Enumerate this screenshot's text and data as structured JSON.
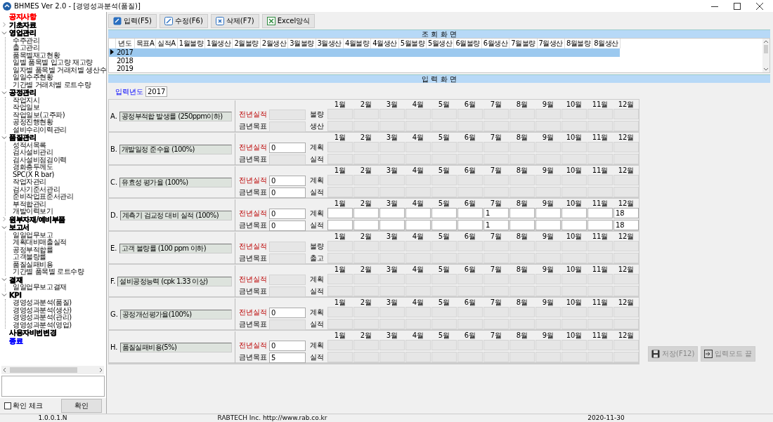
{
  "window": {
    "title": "BHMES Ver 2.0 - [경영성과분석(품질)]"
  },
  "sidebar": {
    "tree": [
      {
        "label": "공지사항",
        "color": "#ff0000"
      },
      {
        "label": "기초자료",
        "color": "#000000",
        "expanded": false
      },
      {
        "label": "영업관리",
        "color": "#000000",
        "expanded": true,
        "children": [
          {
            "label": "수주관리"
          },
          {
            "label": "출고관리"
          },
          {
            "label": "품목별재고현황"
          },
          {
            "label": "일별 품목별 입고량 재고량"
          },
          {
            "label": "일자별 품목별 거래처별 생산수"
          },
          {
            "label": "일일수주현황"
          },
          {
            "label": "기간별 거래처별 로트수량"
          }
        ]
      },
      {
        "label": "공정관리",
        "color": "#000000",
        "expanded": true,
        "children": [
          {
            "label": "작업지시"
          },
          {
            "label": "작업일보"
          },
          {
            "label": "작업일보(고주파)"
          },
          {
            "label": "공정진행현황"
          },
          {
            "label": "설비수리이력관리"
          }
        ]
      },
      {
        "label": "품질관리",
        "color": "#000000",
        "expanded": true,
        "children": [
          {
            "label": "성적서목록"
          },
          {
            "label": "검사설비관리"
          },
          {
            "label": "검사설비점검이력"
          },
          {
            "label": "경화층두께도"
          },
          {
            "label": "SPC(X R bar)"
          },
          {
            "label": "작업자관리"
          },
          {
            "label": "검사기준서관리"
          },
          {
            "label": "준비작업표준서관리"
          },
          {
            "label": "부적합관리"
          },
          {
            "label": "개발이력보기"
          }
        ]
      },
      {
        "label": "원부자재/예비부품",
        "color": "#000000",
        "expanded": false
      },
      {
        "label": "보고서",
        "color": "#000000",
        "expanded": true,
        "children": [
          {
            "label": "일일업무보고"
          },
          {
            "label": "계획대비매출실적"
          },
          {
            "label": "공정부적합률"
          },
          {
            "label": "고객불량률"
          },
          {
            "label": "품질실패비용"
          },
          {
            "label": "기간별 품목별 로트수량"
          }
        ]
      },
      {
        "label": "결재",
        "color": "#000000",
        "expanded": true,
        "children": [
          {
            "label": "일일업무보고결재"
          }
        ]
      },
      {
        "label": "KPI",
        "color": "#000000",
        "expanded": true,
        "children": [
          {
            "label": "경영성과분석(품질)"
          },
          {
            "label": "경영성과분석(생산)"
          },
          {
            "label": "경영성과분석(관리)"
          },
          {
            "label": "경영성과분석(영업)"
          }
        ]
      },
      {
        "label": "사용자비번변경",
        "color": "#000000"
      },
      {
        "label": "종료",
        "color": "#0000ff"
      }
    ],
    "confirm_check": {
      "label": "확인 체크",
      "checked": false
    },
    "confirm_button": "확인"
  },
  "toolbar": [
    {
      "label": "입력(F5)",
      "kind": "input"
    },
    {
      "label": "수정(F6)",
      "kind": "edit"
    },
    {
      "label": "삭제(F7)",
      "kind": "delete"
    },
    {
      "label": "Excel양식",
      "kind": "excel"
    }
  ],
  "query_panel": {
    "title": "조 회 화 면",
    "columns": [
      "년도",
      "목표A",
      "실적A",
      "1월불량",
      "1월생산",
      "2월불량",
      "2월생산",
      "3월불량",
      "3월생산",
      "4월불량",
      "4월생산",
      "5월불량",
      "5월생산",
      "6월불량",
      "6월생산",
      "7월불량",
      "7월생산",
      "8월불량",
      "8월생산"
    ],
    "rows": [
      {
        "year": "2017",
        "selected": true
      },
      {
        "year": "2018",
        "selected": false
      },
      {
        "year": "2019",
        "selected": false
      }
    ]
  },
  "input_panel": {
    "title": "입 력 화 면",
    "year_label": "입력년도",
    "year": "2017",
    "sections": [
      {
        "letter": "A.",
        "title": "공정부적합 발생률 (250ppm이하)",
        "prev": {
          "label": "전년실적"
        },
        "target": {
          "label": "금년목표"
        },
        "months": [
          "1월",
          "2월",
          "3월",
          "4월",
          "5월",
          "6월",
          "7월",
          "8월",
          "9월",
          "10월",
          "11월",
          "12월"
        ],
        "rows": [
          {
            "label": "불량"
          },
          {
            "label": "생산"
          }
        ]
      },
      {
        "letter": "B.",
        "title": "개발일정 준수율 (100%)",
        "prev": {
          "label": "전년실적",
          "value": "0"
        },
        "target": {
          "label": "금년목표"
        },
        "months": [
          "1월",
          "2월",
          "3월",
          "4월",
          "5월",
          "6월",
          "7월",
          "8월",
          "9월",
          "10월",
          "11월",
          "12월"
        ],
        "rows": [
          {
            "label": "계획"
          },
          {
            "label": "실적"
          }
        ]
      },
      {
        "letter": "C.",
        "title": "유효성 평가율 (100%)",
        "prev": {
          "label": "전년실적",
          "value": "0"
        },
        "target": {
          "label": "금년목표",
          "value": "0"
        },
        "months": [
          "1월",
          "2월",
          "3월",
          "4월",
          "5월",
          "6월",
          "7월",
          "8월",
          "9월",
          "10월",
          "11월",
          "12월"
        ],
        "rows": [
          {
            "label": "계획"
          },
          {
            "label": "실적"
          }
        ]
      },
      {
        "letter": "D.",
        "title": "계측기 검교정 대비 실적 (100%)",
        "prev": {
          "label": "전년실적",
          "value": "0"
        },
        "target": {
          "label": "금년목표",
          "value": "0"
        },
        "months": [
          "1월",
          "2월",
          "3월",
          "4월",
          "5월",
          "6월",
          "7월",
          "8월",
          "9월",
          "10월",
          "11월",
          "12월"
        ],
        "rows": [
          {
            "label": "계획",
            "cells": [
              {
                "kind": "blank"
              },
              {
                "kind": "blank"
              },
              {
                "kind": "blank"
              },
              {
                "kind": "blank"
              },
              {
                "kind": "blank"
              },
              {
                "kind": "blank"
              },
              {
                "kind": "value",
                "value": "1"
              },
              {
                "kind": "blank"
              },
              {
                "kind": "blank"
              },
              {
                "kind": "blank"
              },
              {
                "kind": "blank"
              },
              {
                "kind": "value",
                "value": "18"
              }
            ]
          },
          {
            "label": "실적",
            "cells": [
              {
                "kind": "blank"
              },
              {
                "kind": "blank"
              },
              {
                "kind": "blank"
              },
              {
                "kind": "blank"
              },
              {
                "kind": "blank"
              },
              {
                "kind": "blank"
              },
              {
                "kind": "value",
                "value": "1"
              },
              {
                "kind": "blank"
              },
              {
                "kind": "blank"
              },
              {
                "kind": "blank"
              },
              {
                "kind": "blank"
              },
              {
                "kind": "value",
                "value": "18"
              }
            ]
          }
        ]
      },
      {
        "letter": "E.",
        "title": "고객 불량률 (100 ppm 이하)",
        "prev": {
          "label": "전년실적"
        },
        "target": {
          "label": "금년목표"
        },
        "months": [
          "1월",
          "2월",
          "3월",
          "4월",
          "5월",
          "6월",
          "7월",
          "8월",
          "9월",
          "10월",
          "11월",
          "12월"
        ],
        "rows": [
          {
            "label": "불량"
          },
          {
            "label": "출고"
          }
        ]
      },
      {
        "letter": "F.",
        "title": "설비공정능력 (cpk 1.33 이상)",
        "prev": {
          "label": "전년실적"
        },
        "target": {
          "label": "금년목표"
        },
        "months": [
          "1월",
          "2월",
          "3월",
          "4월",
          "5월",
          "6월",
          "7월",
          "8월",
          "9월",
          "10월",
          "11월",
          "12월"
        ],
        "rows": [
          {
            "label": "계획"
          },
          {
            "label": "실적"
          }
        ]
      },
      {
        "letter": "G.",
        "title": "공정개선평가율(100%)",
        "prev": {
          "label": "전년실적",
          "value": "0"
        },
        "target": {
          "label": "금년목표"
        },
        "months": [
          "1월",
          "2월",
          "3월",
          "4월",
          "5월",
          "6월",
          "7월",
          "8월",
          "9월",
          "10월",
          "11월",
          "12월"
        ],
        "rows": [
          {
            "label": "계획"
          },
          {
            "label": "실적"
          }
        ]
      },
      {
        "letter": "H.",
        "title": "품질실패비용(5%)",
        "prev": {
          "label": "전년실적",
          "value": "0"
        },
        "target": {
          "label": "금년목표",
          "value": "5"
        },
        "months": [
          "1월",
          "2월",
          "3월",
          "4월",
          "5월",
          "6월",
          "7월",
          "8월",
          "9월",
          "10월",
          "11월",
          "12월"
        ],
        "rows": [
          {
            "label": "계획"
          },
          {
            "label": "실적"
          }
        ]
      }
    ],
    "buttons": [
      {
        "label": "저장(F12)",
        "kind": "save",
        "disabled": true
      },
      {
        "label": "입력모드 끝",
        "kind": "exit",
        "disabled": true
      }
    ]
  },
  "status_bar": [
    "1.0.0.1.N",
    "RABTECH Inc.  http://www.rab.co.kr",
    "2020-11-30"
  ]
}
